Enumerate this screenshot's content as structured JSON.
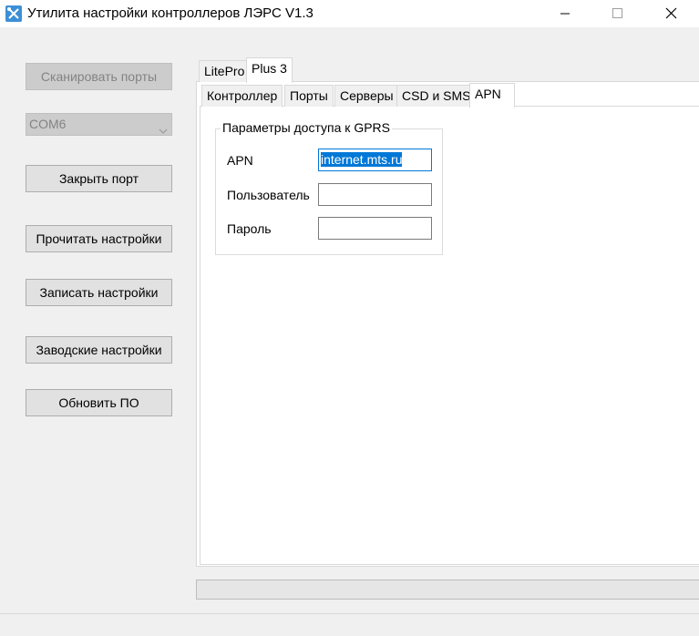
{
  "window": {
    "title": "Утилита настройки контроллеров ЛЭРС V1.3",
    "icon": "tools-icon",
    "controls": [
      "minimize-icon",
      "maximize-icon",
      "close-icon"
    ]
  },
  "left_panel": {
    "scan_ports": "Сканировать порты",
    "port_select": "COM6",
    "close_port": "Закрыть порт",
    "read_settings": "Прочитать настройки",
    "write_settings": "Записать настройки",
    "factory_settings": "Заводские настройки",
    "update_firmware": "Обновить ПО"
  },
  "outer_tabs": [
    {
      "label": "LitePro",
      "active": false
    },
    {
      "label": "Plus 3",
      "active": true
    }
  ],
  "inner_tabs": [
    {
      "label": "Контроллер",
      "active": false
    },
    {
      "label": "Порты",
      "active": false
    },
    {
      "label": "Серверы",
      "active": false
    },
    {
      "label": "CSD и SMS",
      "active": false
    },
    {
      "label": "APN",
      "active": true
    }
  ],
  "gprs_group": {
    "title": "Параметры доступа к GPRS",
    "apn_label": "APN",
    "apn_value": "internet.mts.ru",
    "user_label": "Пользователь",
    "user_value": "",
    "password_label": "Пароль",
    "password_value": ""
  },
  "colors": {
    "accent": "#0078d7",
    "window_bg": "#f0f0f0",
    "panel_bg": "#ffffff",
    "button_bg": "#e1e1e1",
    "disabled_bg": "#cccccc"
  }
}
